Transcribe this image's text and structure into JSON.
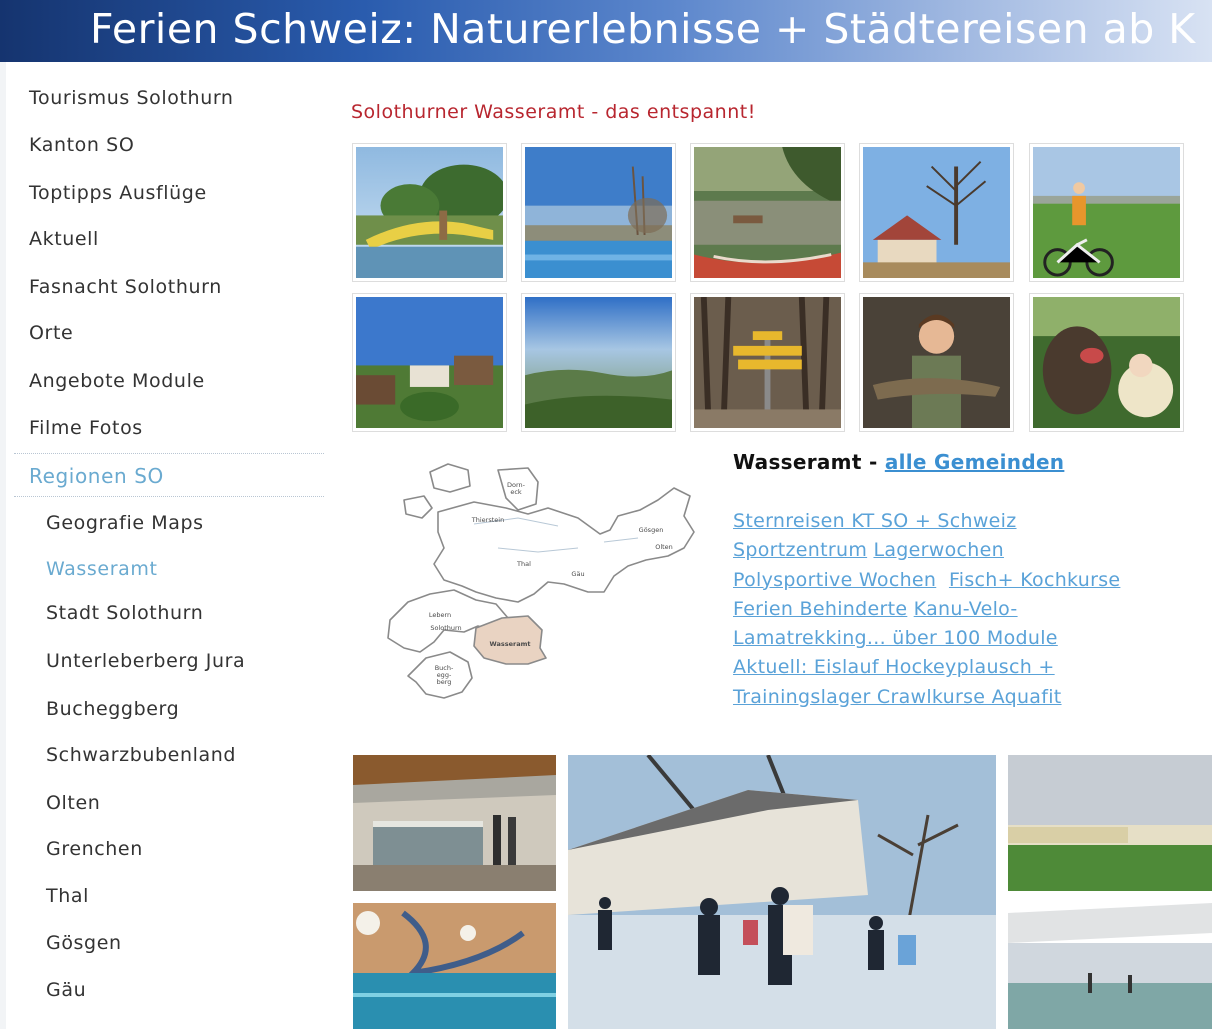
{
  "banner": {
    "title": "Ferien Schweiz: Naturerlebnisse + Städtereisen ab K"
  },
  "nav": {
    "items": [
      {
        "label": "Tourismus Solothurn"
      },
      {
        "label": "Kanton SO"
      },
      {
        "label": "Toptipps Ausflüge"
      },
      {
        "label": "Aktuell"
      },
      {
        "label": "Fasnacht Solothurn"
      },
      {
        "label": "Orte"
      },
      {
        "label": "Angebote Module"
      },
      {
        "label": "Filme Fotos"
      }
    ],
    "region": {
      "label": "Regionen SO"
    },
    "subitems": [
      {
        "label": "Geografie Maps"
      },
      {
        "label": "Wasseramt"
      },
      {
        "label": "Stadt Solothurn"
      },
      {
        "label": "Unterleberberg Jura"
      },
      {
        "label": "Bucheggberg"
      },
      {
        "label": "Schwarzbubenland"
      },
      {
        "label": "Olten"
      },
      {
        "label": "Grenchen"
      },
      {
        "label": "Thal"
      },
      {
        "label": "Gösgen"
      },
      {
        "label": "Gäu"
      }
    ]
  },
  "main": {
    "heading": "Solothurner Wasseramt - das entspannt!",
    "info": {
      "title": "Wasseramt - ",
      "title_link": "alle Gemeinden",
      "links": {
        "sternreisen": "Sternreisen KT SO + Schweiz",
        "sportzentrum": "Sportzentrum",
        "lagerwochen": "Lagerwochen",
        "polysportive": "Polysportive Wochen",
        "fisch": "Fisch+ Kochkurse",
        "behinderte": "Ferien Behinderte",
        "kanu": "Kanu-Velo-",
        "lama": "Lamatrekking... über 100 Module",
        "aktuell": "Aktuell: Eislauf Hockeyplausch +",
        "training": "Trainingslager Crawlkurse Aquafit"
      }
    },
    "map": {
      "labels": {
        "dorneck": "Dorn-\neck",
        "thierstein": "Thierstein",
        "thal": "Thal",
        "goesgen": "Gösgen",
        "olten": "Olten",
        "gaeu": "Gäu",
        "lebern": "Lebern",
        "solothurn": "Solothurn",
        "wasseramt": "Wasseramt",
        "bucheggberg": "Buch-\negg-\nberg"
      }
    }
  },
  "colors": {
    "banner_dark": "#15346f",
    "banner_light": "#d8e2f3",
    "heading_red": "#b8262f",
    "link_blue": "#5aa2d8",
    "active_blue": "#6aaad0",
    "map_highlight": "#e9d3c2"
  }
}
